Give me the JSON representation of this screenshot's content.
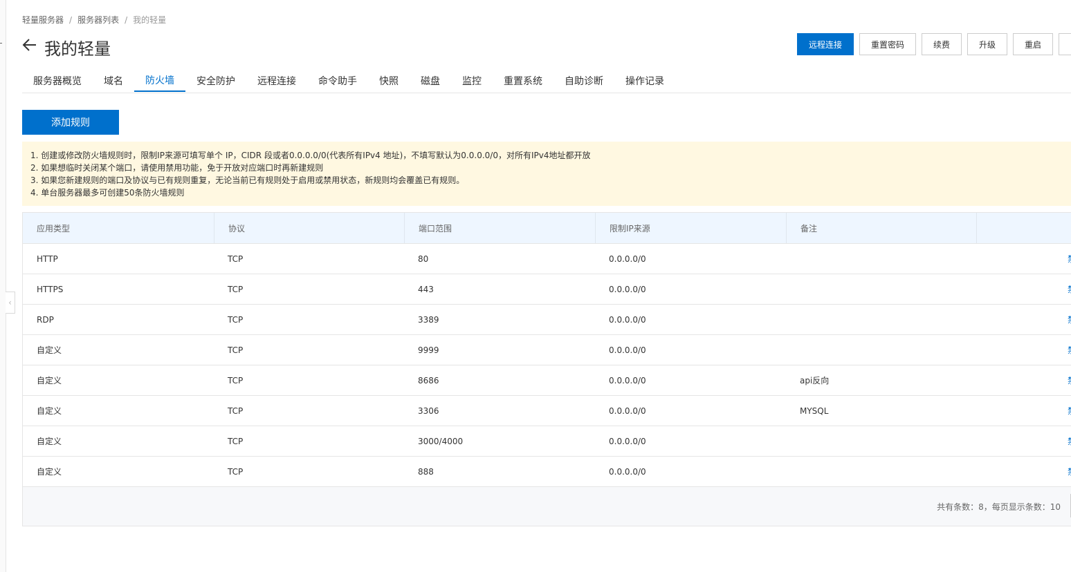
{
  "breadcrumb": {
    "items": [
      "轻量服务器",
      "服务器列表",
      "我的轻量"
    ],
    "separator": "/"
  },
  "page": {
    "title": "我的轻量"
  },
  "toolbar": {
    "remote_connect": "远程连接",
    "reset_password": "重置密码",
    "renew": "续费",
    "upgrade": "升级",
    "restart": "重启"
  },
  "tabs": [
    {
      "label": "服务器概览"
    },
    {
      "label": "域名"
    },
    {
      "label": "防火墙",
      "active": true
    },
    {
      "label": "安全防护"
    },
    {
      "label": "远程连接"
    },
    {
      "label": "命令助手"
    },
    {
      "label": "快照"
    },
    {
      "label": "磁盘"
    },
    {
      "label": "监控"
    },
    {
      "label": "重置系统"
    },
    {
      "label": "自助诊断"
    },
    {
      "label": "操作记录"
    }
  ],
  "firewall": {
    "add_rule_label": "添加规则",
    "notices": [
      "1. 创建或修改防火墙规则时，限制IP来源可填写单个 IP，CIDR 段或者0.0.0.0/0(代表所有IPv4 地址)，不填写默认为0.0.0.0/0，对所有IPv4地址都开放",
      "2. 如果想临时关闭某个端口，请使用禁用功能，免于开放对应端口时再新建规则",
      "3. 如果您新建规则的端口及协议与已有规则重复，无论当前已有规则处于启用或禁用状态，新规则均会覆盖已有规则。",
      "4. 单台服务器最多可创建50条防火墙规则"
    ],
    "columns": [
      "应用类型",
      "协议",
      "端口范围",
      "限制IP来源",
      "备注",
      ""
    ],
    "rows": [
      {
        "app": "HTTP",
        "protocol": "TCP",
        "port": "80",
        "source": "0.0.0.0/0",
        "note": ""
      },
      {
        "app": "HTTPS",
        "protocol": "TCP",
        "port": "443",
        "source": "0.0.0.0/0",
        "note": ""
      },
      {
        "app": "RDP",
        "protocol": "TCP",
        "port": "3389",
        "source": "0.0.0.0/0",
        "note": ""
      },
      {
        "app": "自定义",
        "protocol": "TCP",
        "port": "9999",
        "source": "0.0.0.0/0",
        "note": ""
      },
      {
        "app": "自定义",
        "protocol": "TCP",
        "port": "8686",
        "source": "0.0.0.0/0",
        "note": "api反向"
      },
      {
        "app": "自定义",
        "protocol": "TCP",
        "port": "3306",
        "source": "0.0.0.0/0",
        "note": "MYSQL"
      },
      {
        "app": "自定义",
        "protocol": "TCP",
        "port": "3000/4000",
        "source": "0.0.0.0/0",
        "note": ""
      },
      {
        "app": "自定义",
        "protocol": "TCP",
        "port": "888",
        "source": "0.0.0.0/0",
        "note": ""
      }
    ],
    "row_action_label": "禁",
    "footer": "共有条数：8，每页显示条数：10"
  },
  "colors": {
    "primary": "#0070cc",
    "notice_bg": "#fff8e1",
    "header_bg": "#eef6ff",
    "footer_bg": "#f7f8fa"
  }
}
